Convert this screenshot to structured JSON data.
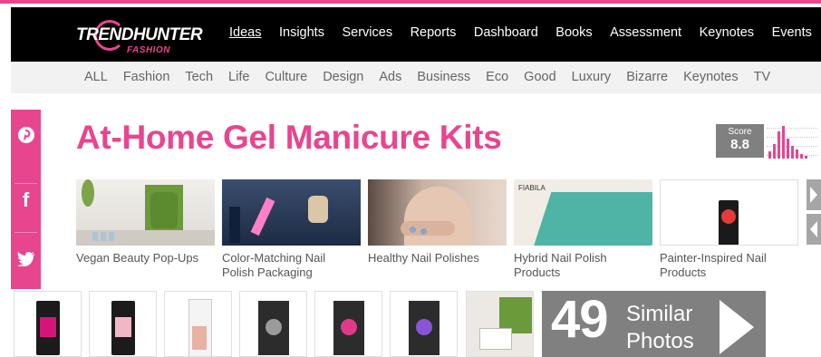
{
  "brand": {
    "logo_word": "TRENDHUNTER",
    "logo_sub": "FASHION",
    "accent_color": "#e8458f"
  },
  "main_nav": {
    "items": [
      "Ideas",
      "Insights",
      "Services",
      "Reports",
      "Dashboard",
      "Books",
      "Assessment",
      "Keynotes",
      "Events"
    ],
    "active": "Ideas"
  },
  "sub_nav": {
    "items": [
      "ALL",
      "Fashion",
      "Tech",
      "Life",
      "Culture",
      "Design",
      "Ads",
      "Business",
      "Eco",
      "Good",
      "Luxury",
      "Bizarre",
      "Keynotes",
      "TV"
    ]
  },
  "social": {
    "icons": [
      "pinterest-icon",
      "facebook-icon",
      "twitter-icon"
    ],
    "glyphs": [
      "℗",
      "f",
      "🐦"
    ]
  },
  "article": {
    "title": "At-Home Gel Manicure Kits"
  },
  "score": {
    "label": "Score",
    "value": "8.8"
  },
  "related": [
    {
      "caption": "Vegan Beauty Pop-Ups"
    },
    {
      "caption": "Color-Matching Nail Polish Packaging"
    },
    {
      "caption": "Healthy Nail Polishes"
    },
    {
      "caption": "Hybrid Nail Polish Products",
      "brand_text": "FIABILA"
    },
    {
      "caption": "Painter-Inspired Nail Products"
    }
  ],
  "similar": {
    "count": "49",
    "word1": "Similar",
    "word2": "Photos"
  }
}
